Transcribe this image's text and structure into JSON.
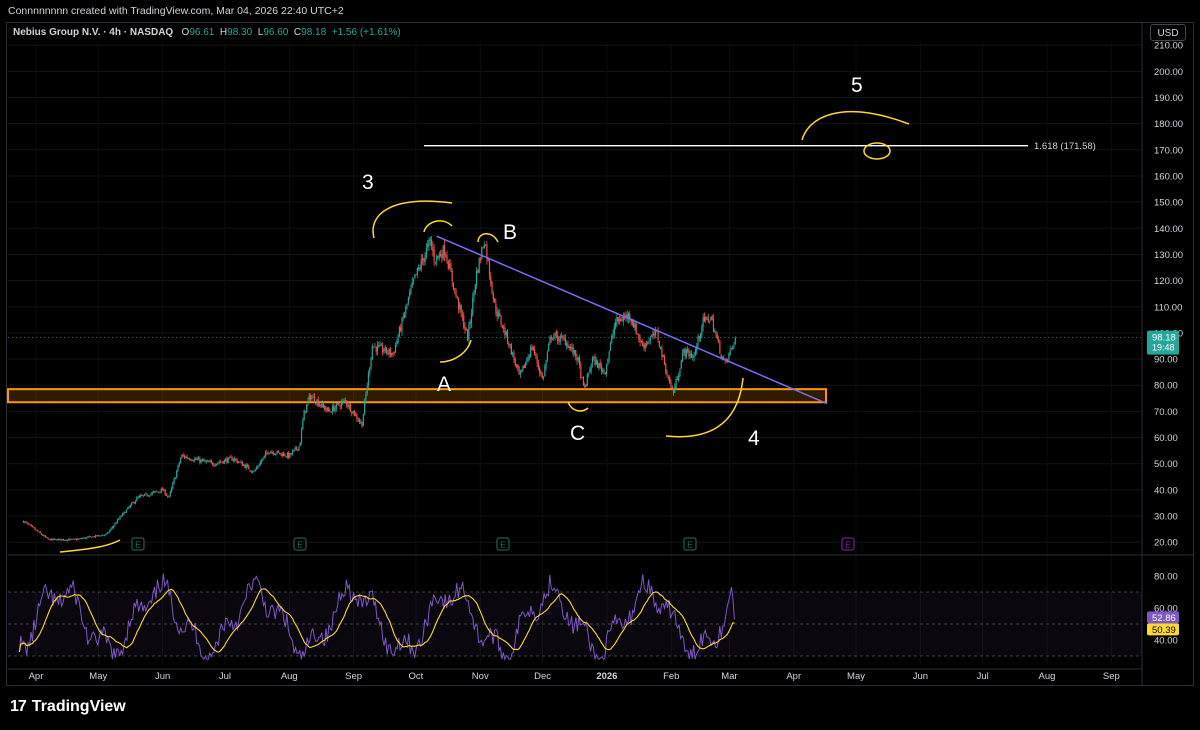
{
  "header": {
    "credit": "Connnnnnnn created with TradingView.com, Mar 04, 2026 22:40 UTC+2"
  },
  "legend": {
    "symbol": "Nebius Group N.V. · 4h · NASDAQ",
    "o_label": "O",
    "o": "96.61",
    "h_label": "H",
    "h": "98.30",
    "l_label": "L",
    "l": "96.60",
    "c_label": "C",
    "c": "98.18",
    "change": "+1.56 (+1.61%)"
  },
  "currency": "USD",
  "price_badge": {
    "price": "98.18",
    "countdown": "19:48"
  },
  "rsi_badges": {
    "rsi": "52.86",
    "rsi_ma": "50.39"
  },
  "footer": {
    "brand": "TradingView"
  },
  "colors": {
    "up": "#26a69a",
    "down": "#ef5350",
    "trendline": "#7b6cf6",
    "zone": "#ff9800",
    "rsi": "#7e57c2",
    "rsi_ma": "#fdd835",
    "annotation": "#ffffff"
  },
  "chart_data": {
    "type": "candlestick",
    "title": "Nebius Group N.V. · 4h · NASDAQ",
    "ylim": [
      15,
      218
    ],
    "y_ticks": [
      20,
      30,
      40,
      50,
      60,
      70,
      80,
      90,
      100,
      110,
      120,
      130,
      140,
      150,
      160,
      170,
      180,
      190,
      200,
      210
    ],
    "x_ticks": [
      "Apr",
      "May",
      "Jun",
      "Jul",
      "Aug",
      "Sep",
      "Oct",
      "Nov",
      "Dec",
      "2026",
      "Feb",
      "Mar",
      "Apr",
      "May",
      "Jun",
      "Jul",
      "Aug",
      "Sep"
    ],
    "last_price": 98.18,
    "price_path": [
      [
        "2025-03-26",
        28
      ],
      [
        "2025-04-07",
        21
      ],
      [
        "2025-04-20",
        21
      ],
      [
        "2025-05-05",
        23
      ],
      [
        "2025-05-12",
        30
      ],
      [
        "2025-05-20",
        37
      ],
      [
        "2025-06-01",
        40
      ],
      [
        "2025-06-04",
        37
      ],
      [
        "2025-06-10",
        53
      ],
      [
        "2025-06-25",
        50
      ],
      [
        "2025-07-05",
        52
      ],
      [
        "2025-07-15",
        47
      ],
      [
        "2025-07-22",
        55
      ],
      [
        "2025-08-01",
        53
      ],
      [
        "2025-08-06",
        57
      ],
      [
        "2025-08-08",
        69
      ],
      [
        "2025-08-11",
        76
      ],
      [
        "2025-08-20",
        70
      ],
      [
        "2025-08-28",
        74
      ],
      [
        "2025-09-05",
        65
      ],
      [
        "2025-09-10",
        95
      ],
      [
        "2025-09-20",
        92
      ],
      [
        "2025-09-30",
        120
      ],
      [
        "2025-10-08",
        135
      ],
      [
        "2025-10-10",
        128
      ],
      [
        "2025-10-15",
        132
      ],
      [
        "2025-10-20",
        115
      ],
      [
        "2025-10-26",
        98
      ],
      [
        "2025-10-30",
        122
      ],
      [
        "2025-11-03",
        136
      ],
      [
        "2025-11-08",
        110
      ],
      [
        "2025-11-14",
        98
      ],
      [
        "2025-11-20",
        83
      ],
      [
        "2025-11-26",
        95
      ],
      [
        "2025-12-01",
        82
      ],
      [
        "2025-12-05",
        99
      ],
      [
        "2025-12-12",
        97
      ],
      [
        "2025-12-18",
        90
      ],
      [
        "2025-12-21",
        78
      ],
      [
        "2025-12-25",
        90
      ],
      [
        "2025-12-31",
        85
      ],
      [
        "2026-01-05",
        104
      ],
      [
        "2026-01-12",
        107
      ],
      [
        "2026-01-18",
        95
      ],
      [
        "2026-01-25",
        100
      ],
      [
        "2026-01-30",
        84
      ],
      [
        "2026-02-02",
        77
      ],
      [
        "2026-02-07",
        93
      ],
      [
        "2026-02-12",
        91
      ],
      [
        "2026-02-16",
        104
      ],
      [
        "2026-02-20",
        106
      ],
      [
        "2026-02-25",
        92
      ],
      [
        "2026-02-27",
        88
      ],
      [
        "2026-03-04",
        98.18
      ]
    ],
    "support_zone": {
      "low": 73.5,
      "high": 78.5
    },
    "trendline": [
      [
        "2025-10-11",
        137
      ],
      [
        "2026-04-17",
        73
      ]
    ],
    "fib_level": {
      "label": "1.618 (171.58)",
      "value": 171.58
    },
    "annotations": [
      "3",
      "A",
      "B",
      "C",
      "4",
      "5"
    ],
    "rsi": {
      "ylim": [
        25,
        90
      ],
      "y_ticks": [
        40,
        60,
        80
      ],
      "last": 52.86,
      "ma_last": 50.39
    }
  }
}
